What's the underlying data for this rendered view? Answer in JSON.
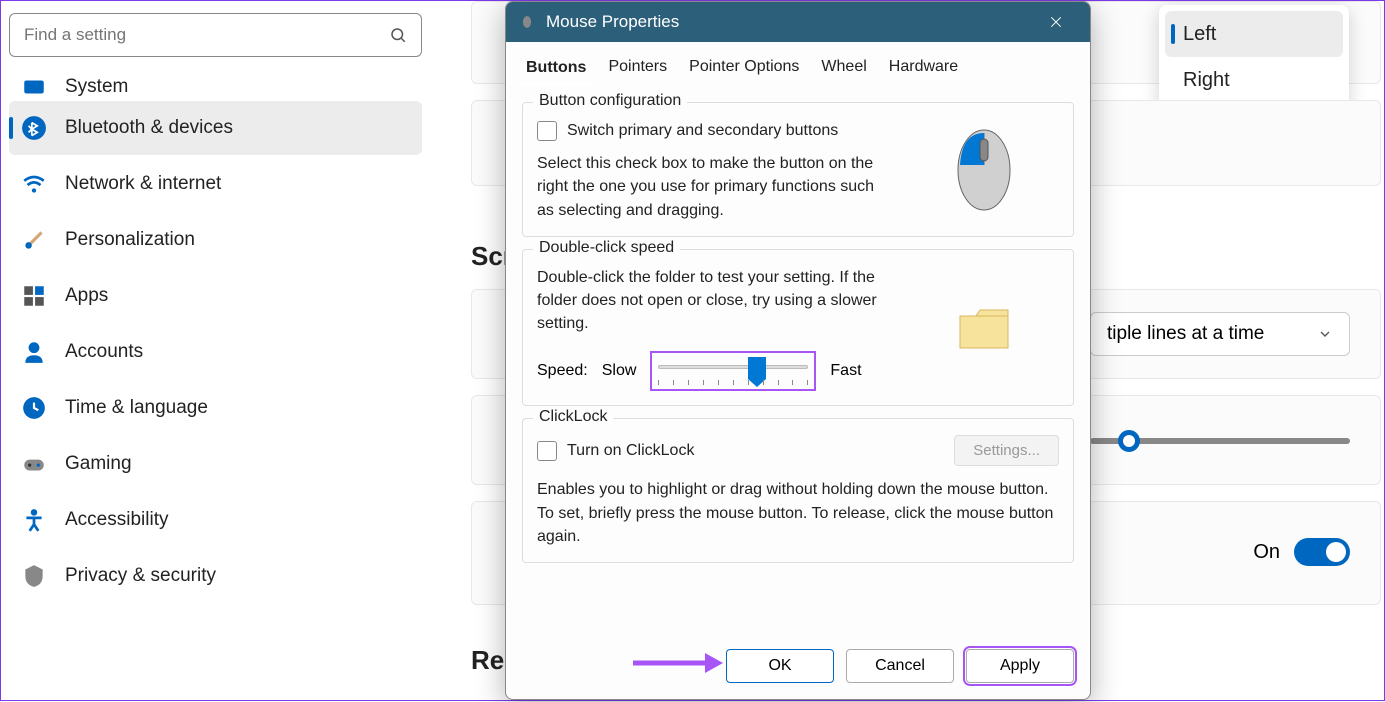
{
  "search": {
    "placeholder": "Find a setting"
  },
  "sidebar": {
    "items": [
      {
        "label": "System"
      },
      {
        "label": "Bluetooth & devices"
      },
      {
        "label": "Network & internet"
      },
      {
        "label": "Personalization"
      },
      {
        "label": "Apps"
      },
      {
        "label": "Accounts"
      },
      {
        "label": "Time & language"
      },
      {
        "label": "Gaming"
      },
      {
        "label": "Accessibility"
      },
      {
        "label": "Privacy & security"
      }
    ]
  },
  "main": {
    "section_scroll_label": "Scr",
    "section_related_label": "Re",
    "popup": {
      "left": "Left",
      "right": "Right"
    },
    "dropdown_value": "tiple lines at a time",
    "toggle_label": "On"
  },
  "dialog": {
    "title": "Mouse Properties",
    "tabs": [
      "Buttons",
      "Pointers",
      "Pointer Options",
      "Wheel",
      "Hardware"
    ],
    "button_config": {
      "legend": "Button configuration",
      "check_label": "Switch primary and secondary buttons",
      "desc": "Select this check box to make the button on the right the one you use for primary functions such as selecting and dragging."
    },
    "double_click": {
      "legend": "Double-click speed",
      "desc": "Double-click the folder to test your setting. If the folder does not open or close, try using a slower setting.",
      "speed_label": "Speed:",
      "slow": "Slow",
      "fast": "Fast"
    },
    "clicklock": {
      "legend": "ClickLock",
      "check_label": "Turn on ClickLock",
      "settings_btn": "Settings...",
      "desc": "Enables you to highlight or drag without holding down the mouse button. To set, briefly press the mouse button. To release, click the mouse button again."
    },
    "footer": {
      "ok": "OK",
      "cancel": "Cancel",
      "apply": "Apply"
    }
  }
}
